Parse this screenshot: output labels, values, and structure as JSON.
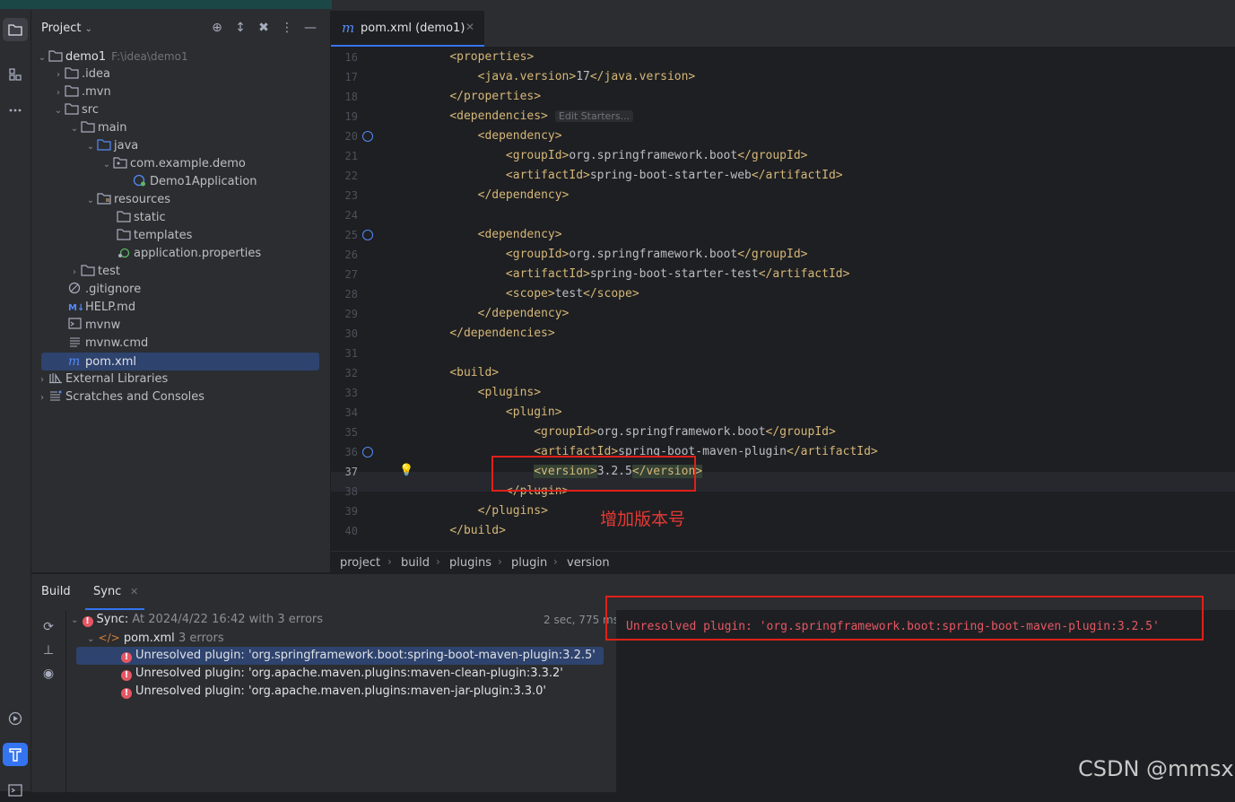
{
  "project_panel": {
    "title": "Project",
    "tree": [
      {
        "label": "demo1",
        "sub": "F:\\idea\\demo1"
      },
      {
        "label": ".idea"
      },
      {
        "label": ".mvn"
      },
      {
        "label": "src"
      },
      {
        "label": "main"
      },
      {
        "label": "java"
      },
      {
        "label": "com.example.demo"
      },
      {
        "label": "Demo1Application"
      },
      {
        "label": "resources"
      },
      {
        "label": "static"
      },
      {
        "label": "templates"
      },
      {
        "label": "application.properties"
      },
      {
        "label": "test"
      },
      {
        "label": ".gitignore"
      },
      {
        "label": "HELP.md"
      },
      {
        "label": "mvnw"
      },
      {
        "label": "mvnw.cmd"
      },
      {
        "label": "pom.xml"
      },
      {
        "label": "External Libraries"
      },
      {
        "label": "Scratches and Consoles"
      }
    ],
    "md_badge": "M↓"
  },
  "editor": {
    "tab_label": "pom.xml (demo1)",
    "tab_icon_glyph": "m",
    "edit_starters_hint": "Edit Starters...",
    "lines": [
      {
        "n": "16",
        "indent": "    ",
        "open": "<properties>",
        "text": "",
        "close": ""
      },
      {
        "n": "17",
        "indent": "        ",
        "open": "<java.version>",
        "text": "17",
        "close": "</java.version>"
      },
      {
        "n": "18",
        "indent": "    ",
        "open": "</properties>",
        "text": "",
        "close": ""
      },
      {
        "n": "19",
        "indent": "    ",
        "open": "<dependencies>",
        "text": "",
        "close": ""
      },
      {
        "n": "20",
        "indent": "        ",
        "open": "<dependency>",
        "text": "",
        "close": ""
      },
      {
        "n": "21",
        "indent": "            ",
        "open": "<groupId>",
        "text": "org.springframework.boot",
        "close": "</groupId>"
      },
      {
        "n": "22",
        "indent": "            ",
        "open": "<artifactId>",
        "text": "spring-boot-starter-web",
        "close": "</artifactId>"
      },
      {
        "n": "23",
        "indent": "        ",
        "open": "</dependency>",
        "text": "",
        "close": ""
      },
      {
        "n": "24",
        "indent": "",
        "open": "",
        "text": "",
        "close": ""
      },
      {
        "n": "25",
        "indent": "        ",
        "open": "<dependency>",
        "text": "",
        "close": ""
      },
      {
        "n": "26",
        "indent": "            ",
        "open": "<groupId>",
        "text": "org.springframework.boot",
        "close": "</groupId>"
      },
      {
        "n": "27",
        "indent": "            ",
        "open": "<artifactId>",
        "text": "spring-boot-starter-test",
        "close": "</artifactId>"
      },
      {
        "n": "28",
        "indent": "            ",
        "open": "<scope>",
        "text": "test",
        "close": "</scope>"
      },
      {
        "n": "29",
        "indent": "        ",
        "open": "</dependency>",
        "text": "",
        "close": ""
      },
      {
        "n": "30",
        "indent": "    ",
        "open": "</dependencies>",
        "text": "",
        "close": ""
      },
      {
        "n": "31",
        "indent": "",
        "open": "",
        "text": "",
        "close": ""
      },
      {
        "n": "32",
        "indent": "    ",
        "open": "<build>",
        "text": "",
        "close": ""
      },
      {
        "n": "33",
        "indent": "        ",
        "open": "<plugins>",
        "text": "",
        "close": ""
      },
      {
        "n": "34",
        "indent": "            ",
        "open": "<plugin>",
        "text": "",
        "close": ""
      },
      {
        "n": "35",
        "indent": "                ",
        "open": "<groupId>",
        "text": "org.springframework.boot",
        "close": "</groupId>"
      },
      {
        "n": "36",
        "indent": "                ",
        "open": "<artifactId>",
        "text": "spring-boot-maven-plugin",
        "close": "</artifactId>"
      },
      {
        "n": "37",
        "indent": "                ",
        "open": "<version>",
        "text": "3.2.5",
        "close": "</version>"
      },
      {
        "n": "38",
        "indent": "            ",
        "open": "</plugin>",
        "text": "",
        "close": ""
      },
      {
        "n": "39",
        "indent": "        ",
        "open": "</plugins>",
        "text": "",
        "close": ""
      },
      {
        "n": "40",
        "indent": "    ",
        "open": "</build>",
        "text": "",
        "close": ""
      }
    ],
    "breadcrumb": [
      "project",
      "build",
      "plugins",
      "plugin",
      "version"
    ],
    "annotation": "增加版本号"
  },
  "build_panel": {
    "tabs": [
      "Build",
      "Sync"
    ],
    "sync_label": "Sync:",
    "sync_detail": "At 2024/4/22 16:42 with 3 errors",
    "sync_time": "2 sec, 775 ms",
    "pom_label": "pom.xml",
    "pom_errors": "3 errors",
    "errors": [
      "Unresolved plugin: 'org.springframework.boot:spring-boot-maven-plugin:3.2.5'",
      "Unresolved plugin: 'org.apache.maven.plugins:maven-clean-plugin:3.3.2'",
      "Unresolved plugin: 'org.apache.maven.plugins:maven-jar-plugin:3.3.0'"
    ],
    "console_output": "Unresolved plugin: 'org.springframework.boot:spring-boot-maven-plugin:3.2.5'"
  },
  "watermark": "CSDN @mmsx",
  "colors": {
    "accent": "#3574f0",
    "error": "#e55765",
    "tag": "#d5b778",
    "annotation": "#e0201a"
  }
}
